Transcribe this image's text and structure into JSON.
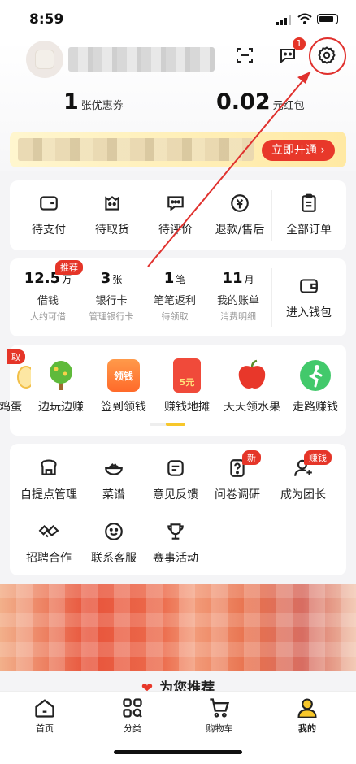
{
  "status_bar": {
    "time": "8:59"
  },
  "header": {
    "message_badge": "1",
    "coupons": {
      "count": "1",
      "label": "张优惠券"
    },
    "red_packet": {
      "amount": "0.02",
      "label": "元红包"
    }
  },
  "vip_banner": {
    "button_label": "立即开通 ›"
  },
  "orders": {
    "items": [
      {
        "label": "待支付",
        "icon": "wallet-icon"
      },
      {
        "label": "待取货",
        "icon": "pickup-bag-icon"
      },
      {
        "label": "待评价",
        "icon": "comment-icon"
      },
      {
        "label": "退款/售后",
        "icon": "refund-icon"
      },
      {
        "label": "全部订单",
        "icon": "order-list-icon"
      }
    ]
  },
  "wallet": {
    "items": [
      {
        "value": "12.5",
        "unit": "万",
        "label": "借钱",
        "sub": "大约可借",
        "tag": "推荐"
      },
      {
        "value": "3",
        "unit": "张",
        "label": "银行卡",
        "sub": "管理银行卡"
      },
      {
        "value": "1",
        "unit": "笔",
        "label": "笔笔返利",
        "sub": "待领取"
      },
      {
        "value": "11",
        "unit": "月",
        "label": "我的账单",
        "sub": "消费明细"
      }
    ],
    "enter_label": "进入钱包"
  },
  "games": {
    "partial_left_tag": "取",
    "items": [
      {
        "label": "鸡蛋"
      },
      {
        "label": "边玩边赚"
      },
      {
        "label": "签到领钱",
        "icon_text": "领钱"
      },
      {
        "label": "赚钱地摊",
        "icon_text": "5元"
      },
      {
        "label": "天天领水果"
      },
      {
        "label": "走路赚钱"
      }
    ]
  },
  "services": {
    "items": [
      {
        "label": "自提点管理",
        "icon": "store-icon"
      },
      {
        "label": "菜谱",
        "icon": "recipe-bowl-icon"
      },
      {
        "label": "意见反馈",
        "icon": "feedback-icon"
      },
      {
        "label": "问卷调研",
        "icon": "survey-icon",
        "tag": "新"
      },
      {
        "label": "成为团长",
        "icon": "leader-icon",
        "tag": "赚钱"
      },
      {
        "label": "招聘合作",
        "icon": "handshake-icon"
      },
      {
        "label": "联系客服",
        "icon": "customer-service-icon"
      },
      {
        "label": "赛事活动",
        "icon": "trophy-icon"
      }
    ]
  },
  "recommend": {
    "title": "为您推荐"
  },
  "tabbar": {
    "items": [
      {
        "label": "首页",
        "icon": "home-icon"
      },
      {
        "label": "分类",
        "icon": "category-icon"
      },
      {
        "label": "购物车",
        "icon": "cart-icon"
      },
      {
        "label": "我的",
        "icon": "profile-icon",
        "active": true
      }
    ]
  },
  "colors": {
    "accent": "#e8382a",
    "vip_bg": "#ffeaa8",
    "active_tab": "#f7c72a"
  }
}
